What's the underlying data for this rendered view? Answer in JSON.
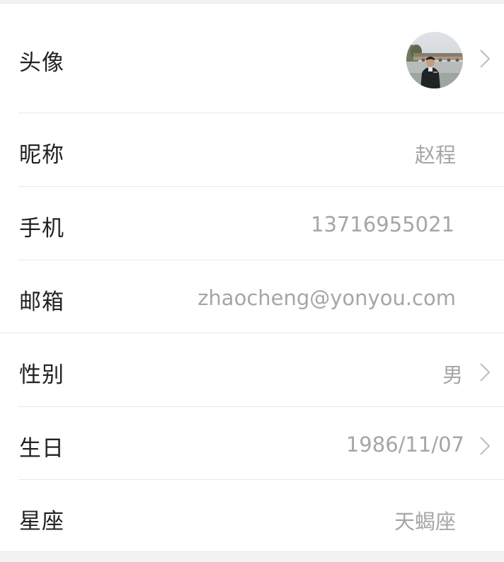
{
  "profile": {
    "rows": [
      {
        "label": "头像",
        "value": ""
      },
      {
        "label": "昵称",
        "value": "赵程"
      },
      {
        "label": "手机",
        "value": "13716955021"
      },
      {
        "label": "邮箱",
        "value": "zhaocheng@yonyou.com"
      },
      {
        "label": "性别",
        "value": "男"
      },
      {
        "label": "生日",
        "value": "1986/11/07"
      },
      {
        "label": "星座",
        "value": "天蝎座"
      }
    ]
  },
  "colors": {
    "label": "#222222",
    "value": "#a6a6a6",
    "divider": "#e8e8e8",
    "background": "#f2f2f2"
  },
  "icons": {
    "chevron": "chevron-right-icon",
    "avatar": "user-avatar-photo"
  }
}
